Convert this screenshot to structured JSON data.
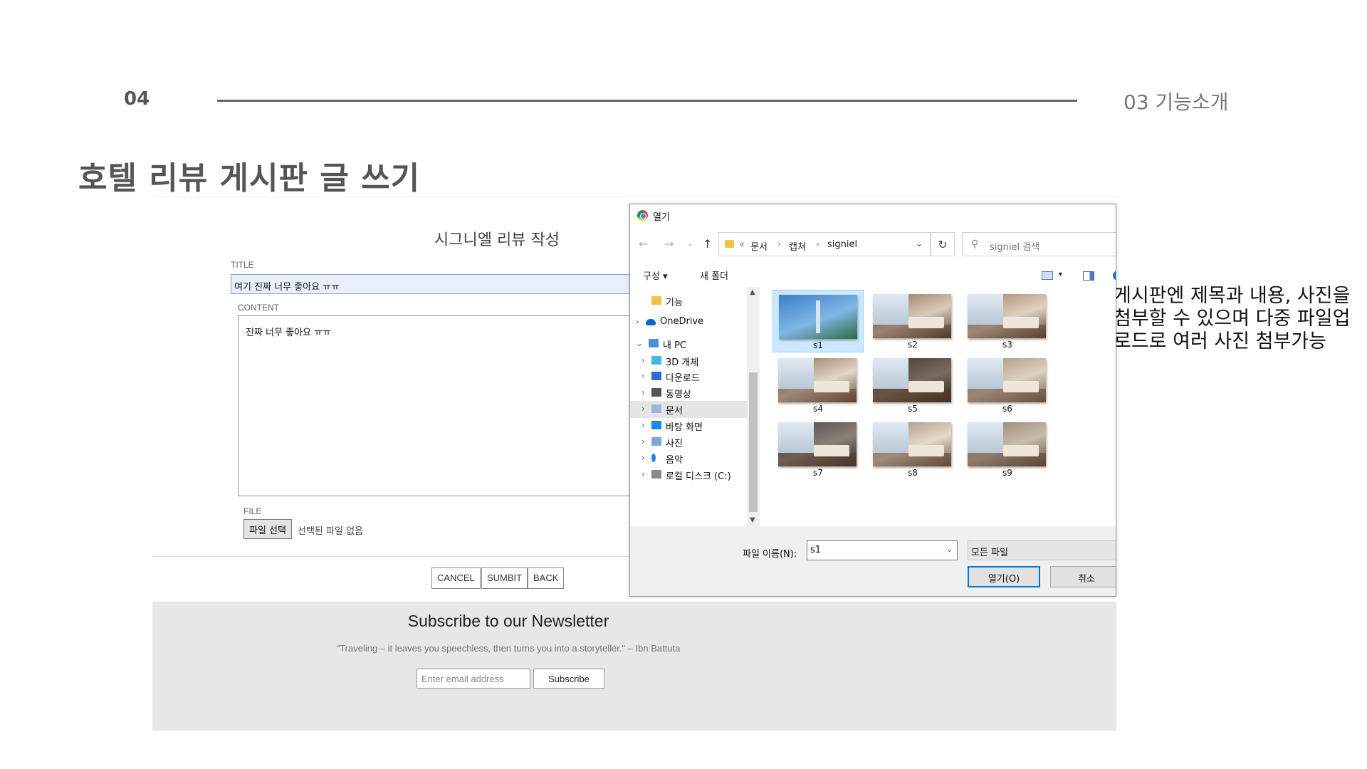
{
  "slide": {
    "number": "04",
    "section": "03 기능소개",
    "title": "호텔 리뷰 게시판 글 쓰기",
    "note": "게시판엔 제목과 내용, 사진을\n첨부할 수 있으며 다중 파일업\n로드로 여러 사진 첨부가능"
  },
  "form": {
    "heading": "시그니엘 리뷰 작성",
    "title_label": "TITLE",
    "title_value": "여기 진짜 너무 좋아요 ㅠㅠ",
    "content_label": "CONTENT",
    "content_value": "진짜 너무 좋아요 ㅠㅠ",
    "file_label": "FILE",
    "file_button": "파일 선택",
    "file_status": "선택된 파일 없음",
    "buttons": {
      "cancel": "CANCEL",
      "submit": "SUMBIT",
      "back": "BACK"
    }
  },
  "newsletter": {
    "title": "Subscribe to our Newsletter",
    "quote": "\"Traveling – it leaves you speechless, then turns you into a storyteller.\" – Ibn Battuta",
    "email_placeholder": "Enter email address",
    "button": "Subscribe"
  },
  "dialog": {
    "title": "열기",
    "breadcrumb": [
      "«",
      "문서",
      "›",
      "캡쳐",
      "›",
      "signiel"
    ],
    "search_placeholder": "signiel 검색",
    "toolbar": {
      "organize": "구성 ▾",
      "new_folder": "새 폴더"
    },
    "nav_items": [
      {
        "label": "기능",
        "icon": "folder-icon",
        "color": "#f2c04b",
        "chevron": ""
      },
      {
        "label": "OneDrive",
        "icon": "onedrive-icon",
        "color": "#0a68c9",
        "chevron": "›"
      },
      {
        "label": "내 PC",
        "icon": "pc-icon",
        "color": "#4a90d9",
        "chevron": "⌄"
      },
      {
        "label": "3D 개체",
        "icon": "3d-objects-icon",
        "color": "#47b6e8",
        "chevron": "›"
      },
      {
        "label": "다운로드",
        "icon": "download-icon",
        "color": "#2a6fd1",
        "chevron": "›"
      },
      {
        "label": "동영상",
        "icon": "video-icon",
        "color": "#555555",
        "chevron": "›"
      },
      {
        "label": "문서",
        "icon": "documents-icon",
        "color": "#9fb6d8",
        "chevron": "›"
      },
      {
        "label": "바탕 화면",
        "icon": "desktop-icon",
        "color": "#1e88e5",
        "chevron": "›"
      },
      {
        "label": "사진",
        "icon": "pictures-icon",
        "color": "#7fa7d6",
        "chevron": "›"
      },
      {
        "label": "음악",
        "icon": "music-icon",
        "color": "#1e88e5",
        "chevron": "›"
      },
      {
        "label": "로컬 디스크 (C:)",
        "icon": "disk-icon",
        "color": "#8a8a8a",
        "chevron": "›"
      }
    ],
    "files": [
      "s1",
      "s2",
      "s3",
      "s4",
      "s5",
      "s6",
      "s7",
      "s8",
      "s9"
    ],
    "selected_file": "s1",
    "filename_label": "파일 이름(N):",
    "filename_value": "s1",
    "filetype": "모든 파일",
    "open_button": "열기(O)",
    "cancel_button": "취소"
  }
}
